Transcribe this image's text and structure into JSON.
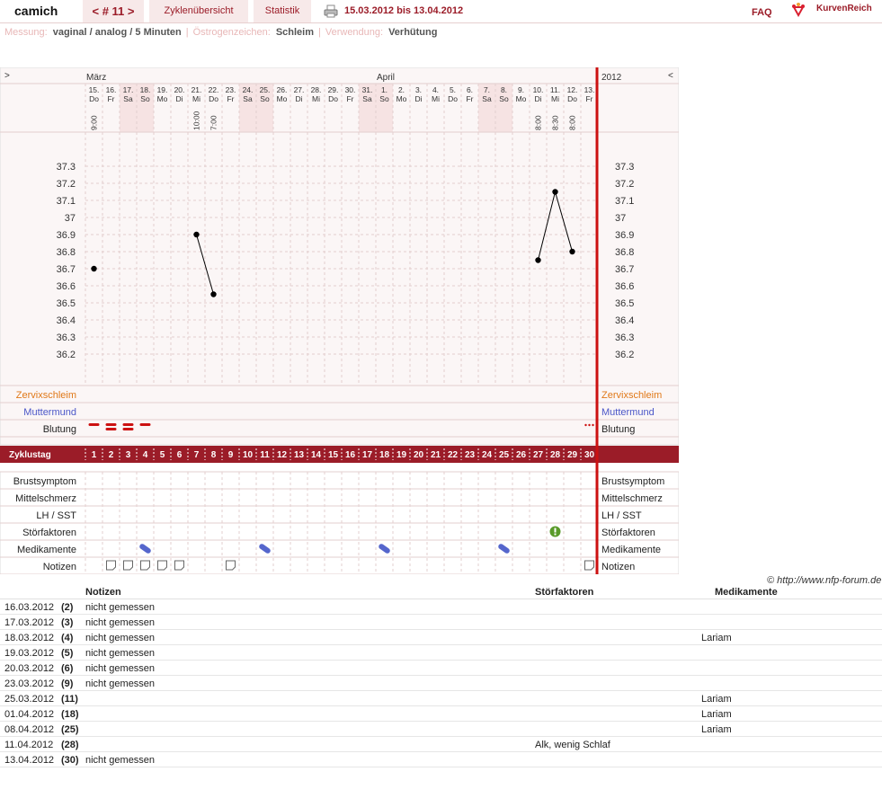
{
  "header": {
    "user": "camich",
    "cycle_nav": "< # 11 >",
    "tab_overview": "Zyklenübersicht",
    "tab_stats": "Statistik",
    "daterange": "15.03.2012 bis 13.04.2012",
    "faq": "FAQ",
    "logo_text": "KurvenReich"
  },
  "settings": {
    "measure_label": "Messung:",
    "measure_value": "vaginal / analog / 5 Minuten",
    "estrogen_label": "Östrogenzeichen:",
    "estrogen_value": "Schleim",
    "usage_label": "Verwendung:",
    "usage_value": "Verhütung"
  },
  "chart": {
    "left_arrow": ">",
    "right_arrow": "<",
    "month1": "März",
    "month2": "April",
    "year": "2012",
    "days": [
      {
        "n": "15.",
        "w": "Do",
        "t": "9:00",
        "we": false
      },
      {
        "n": "16.",
        "w": "Fr",
        "t": "",
        "we": false
      },
      {
        "n": "17.",
        "w": "Sa",
        "t": "",
        "we": true
      },
      {
        "n": "18.",
        "w": "So",
        "t": "",
        "we": true
      },
      {
        "n": "19.",
        "w": "Mo",
        "t": "",
        "we": false
      },
      {
        "n": "20.",
        "w": "Di",
        "t": "",
        "we": false
      },
      {
        "n": "21.",
        "w": "Mi",
        "t": "10:00",
        "we": false
      },
      {
        "n": "22.",
        "w": "Do",
        "t": "7:00",
        "we": false
      },
      {
        "n": "23.",
        "w": "Fr",
        "t": "",
        "we": false
      },
      {
        "n": "24.",
        "w": "Sa",
        "t": "",
        "we": true
      },
      {
        "n": "25.",
        "w": "So",
        "t": "",
        "we": true
      },
      {
        "n": "26.",
        "w": "Mo",
        "t": "",
        "we": false
      },
      {
        "n": "27.",
        "w": "Di",
        "t": "",
        "we": false
      },
      {
        "n": "28.",
        "w": "Mi",
        "t": "",
        "we": false
      },
      {
        "n": "29.",
        "w": "Do",
        "t": "",
        "we": false
      },
      {
        "n": "30.",
        "w": "Fr",
        "t": "",
        "we": false
      },
      {
        "n": "31.",
        "w": "Sa",
        "t": "",
        "we": true
      },
      {
        "n": "1.",
        "w": "So",
        "t": "",
        "we": true
      },
      {
        "n": "2.",
        "w": "Mo",
        "t": "",
        "we": false
      },
      {
        "n": "3.",
        "w": "Di",
        "t": "",
        "we": false
      },
      {
        "n": "4.",
        "w": "Mi",
        "t": "",
        "we": false
      },
      {
        "n": "5.",
        "w": "Do",
        "t": "",
        "we": false
      },
      {
        "n": "6.",
        "w": "Fr",
        "t": "",
        "we": false
      },
      {
        "n": "7.",
        "w": "Sa",
        "t": "",
        "we": true
      },
      {
        "n": "8.",
        "w": "So",
        "t": "",
        "we": true
      },
      {
        "n": "9.",
        "w": "Mo",
        "t": "",
        "we": false
      },
      {
        "n": "10.",
        "w": "Di",
        "t": "8:00",
        "we": false
      },
      {
        "n": "11.",
        "w": "Mi",
        "t": "8:30",
        "we": false
      },
      {
        "n": "12.",
        "w": "Do",
        "t": "8:00",
        "we": false
      },
      {
        "n": "13.",
        "w": "Fr",
        "t": "",
        "we": false
      }
    ],
    "y_ticks": [
      "37.3",
      "37.2",
      "37.1",
      "37",
      "36.9",
      "36.8",
      "36.7",
      "36.6",
      "36.5",
      "36.4",
      "36.3",
      "36.2"
    ],
    "rows": {
      "cervix": "Zervixschleim",
      "os": "Muttermund",
      "bleeding": "Blutung",
      "cycleday": "Zyklustag",
      "breast": "Brustsymptom",
      "midpain": "Mittelschmerz",
      "lh": "LH / SST",
      "disturb": "Störfaktoren",
      "meds": "Medikamente",
      "notes": "Notizen"
    },
    "cycle_days": [
      "1",
      "2",
      "3",
      "4",
      "5",
      "6",
      "7",
      "8",
      "9",
      "10",
      "11",
      "12",
      "13",
      "14",
      "15",
      "16",
      "17",
      "18",
      "19",
      "20",
      "21",
      "22",
      "23",
      "24",
      "25",
      "26",
      "27",
      "28",
      "29",
      "30"
    ],
    "colors": {
      "accent": "#9b1c28",
      "cervix": "#e07818",
      "os": "#4a56c8",
      "grid": "#e3cfcf",
      "weekend": "#f6e3e3"
    }
  },
  "chart_data": {
    "type": "line",
    "x": [
      1,
      2,
      3,
      4,
      5,
      6,
      7,
      8,
      9,
      10,
      11,
      12,
      13,
      14,
      15,
      16,
      17,
      18,
      19,
      20,
      21,
      22,
      23,
      24,
      25,
      26,
      27,
      28,
      29,
      30
    ],
    "series": [
      {
        "values": [
          36.7,
          null,
          null,
          null,
          null,
          null,
          36.9,
          36.55,
          null,
          null,
          null,
          null,
          null,
          null,
          null,
          null,
          null,
          null,
          null,
          null,
          null,
          null,
          null,
          null,
          null,
          null,
          36.75,
          37.15,
          36.8,
          null
        ]
      }
    ],
    "ylim": [
      36.1,
      37.4
    ],
    "bleeding_days": {
      "heavy": [
        1,
        2,
        3,
        4
      ],
      "spotting": [
        30
      ]
    },
    "disturbance_days": [
      28
    ],
    "medication_days": [
      4,
      11,
      18,
      25
    ],
    "note_days": [
      2,
      3,
      4,
      5,
      6,
      9,
      30
    ]
  },
  "copyright": "© http://www.nfp-forum.de",
  "notes_table": {
    "col_notes": "Notizen",
    "col_disturb": "Störfaktoren",
    "col_meds": "Medikamente",
    "rows": [
      {
        "date": "16.03.2012",
        "day": "(2)",
        "note": "nicht gemessen",
        "dist": "",
        "med": ""
      },
      {
        "date": "17.03.2012",
        "day": "(3)",
        "note": "nicht gemessen",
        "dist": "",
        "med": ""
      },
      {
        "date": "18.03.2012",
        "day": "(4)",
        "note": "nicht gemessen",
        "dist": "",
        "med": "Lariam"
      },
      {
        "date": "19.03.2012",
        "day": "(5)",
        "note": "nicht gemessen",
        "dist": "",
        "med": ""
      },
      {
        "date": "20.03.2012",
        "day": "(6)",
        "note": "nicht gemessen",
        "dist": "",
        "med": ""
      },
      {
        "date": "23.03.2012",
        "day": "(9)",
        "note": "nicht gemessen",
        "dist": "",
        "med": ""
      },
      {
        "date": "25.03.2012",
        "day": "(11)",
        "note": "",
        "dist": "",
        "med": "Lariam"
      },
      {
        "date": "01.04.2012",
        "day": "(18)",
        "note": "",
        "dist": "",
        "med": "Lariam"
      },
      {
        "date": "08.04.2012",
        "day": "(25)",
        "note": "",
        "dist": "",
        "med": "Lariam"
      },
      {
        "date": "11.04.2012",
        "day": "(28)",
        "note": "",
        "dist": "Alk, wenig Schlaf",
        "med": ""
      },
      {
        "date": "13.04.2012",
        "day": "(30)",
        "note": "nicht gemessen",
        "dist": "",
        "med": ""
      }
    ]
  }
}
